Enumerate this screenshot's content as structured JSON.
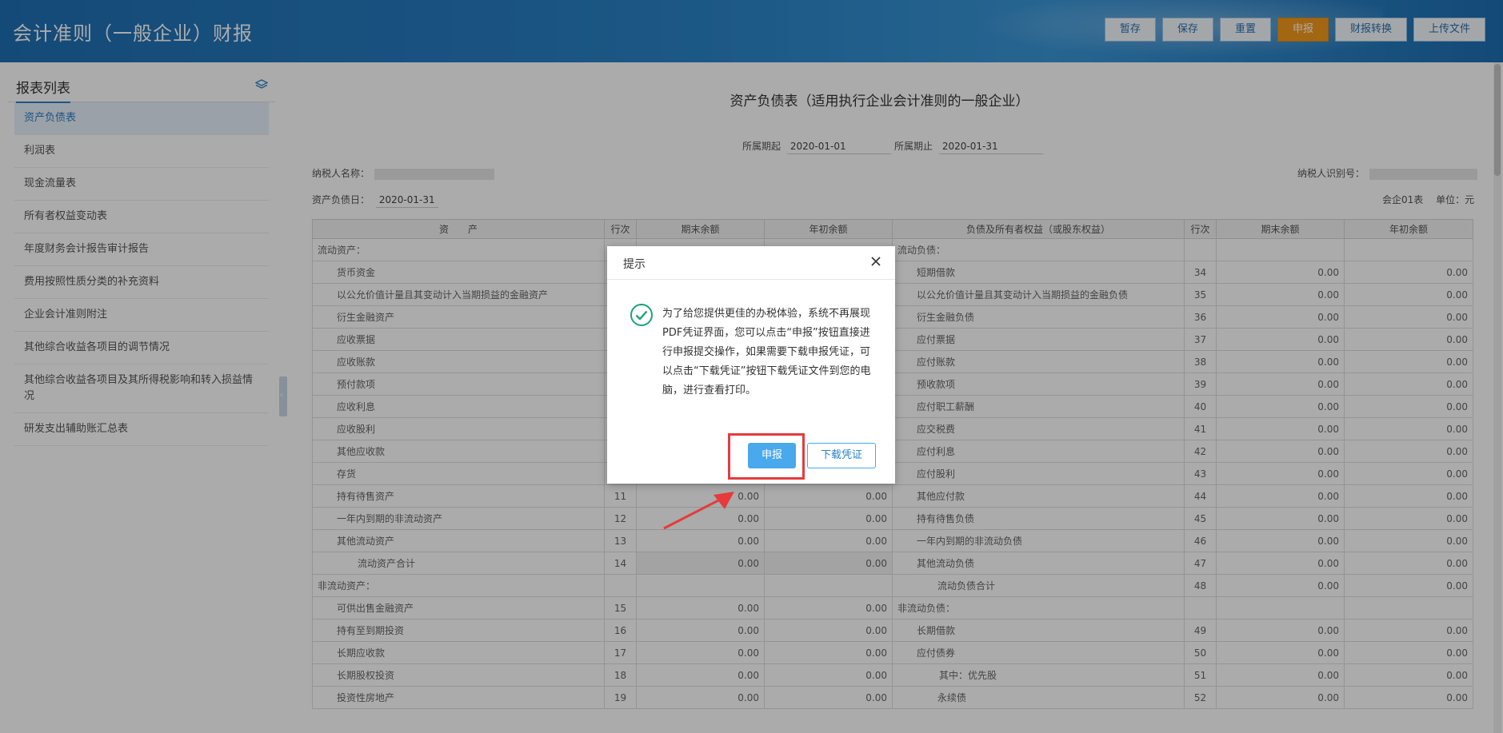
{
  "app": {
    "title": "会计准则（一般企业）财报"
  },
  "toolbar": {
    "buttons": [
      {
        "label": "暂存"
      },
      {
        "label": "保存"
      },
      {
        "label": "重置"
      },
      {
        "label": "申报"
      },
      {
        "label": "财报转换"
      },
      {
        "label": "上传文件"
      }
    ],
    "accent": "#f39a1d"
  },
  "sidebar": {
    "title": "报表列表",
    "icon": "layers-icon",
    "items": [
      {
        "label": "资产负债表"
      },
      {
        "label": "利润表"
      },
      {
        "label": "现金流量表"
      },
      {
        "label": "所有者权益变动表"
      },
      {
        "label": "年度财务会计报告审计报告"
      },
      {
        "label": "费用按照性质分类的补充资料"
      },
      {
        "label": "企业会计准则附注"
      },
      {
        "label": "其他综合收益各项目的调节情况"
      },
      {
        "label": "其他综合收益各项目及其所得税影响和转入损益情况"
      },
      {
        "label": "研发支出辅助账汇总表"
      }
    ]
  },
  "report": {
    "title": "资产负债表（适用执行企业会计准则的一般企业）",
    "period_start_label": "所属期起",
    "period_start": "2020-01-01",
    "period_end_label": "所属期止",
    "period_end": "2020-01-31",
    "taxpayer_name_label": "纳税人名称：",
    "taxpayer_id_label": "纳税人识别号：",
    "date_label": "资产负债日：",
    "date": "2020-01-31",
    "form_no": "会企01表",
    "unit": "单位：元",
    "headers": [
      "资　　产",
      "行次",
      "期末余额",
      "年初余额",
      "负债及所有者权益（或股东权益）",
      "行次",
      "期末余额",
      "年初余额"
    ],
    "rows": [
      [
        "流动资产：",
        "",
        "",
        "",
        "流动负债：",
        "",
        "",
        ""
      ],
      [
        "货币资金",
        "",
        "",
        "",
        "短期借款",
        "34",
        "0.00",
        "0.00"
      ],
      [
        "以公允价值计量且其变动计入当期损益的金融资产",
        "",
        "",
        "",
        "以公允价值计量且其变动计入当期损益的金融负债",
        "35",
        "0.00",
        "0.00"
      ],
      [
        "衍生金融资产",
        "",
        "",
        "",
        "衍生金融负债",
        "36",
        "0.00",
        "0.00"
      ],
      [
        "应收票据",
        "",
        "",
        "",
        "应付票据",
        "37",
        "0.00",
        "0.00"
      ],
      [
        "应收账款",
        "",
        "",
        "",
        "应付账款",
        "38",
        "0.00",
        "0.00"
      ],
      [
        "预付款项",
        "",
        "",
        "",
        "预收款项",
        "39",
        "0.00",
        "0.00"
      ],
      [
        "应收利息",
        "",
        "",
        "",
        "应付职工薪酬",
        "40",
        "0.00",
        "0.00"
      ],
      [
        "应收股利",
        "",
        "",
        "",
        "应交税费",
        "41",
        "0.00",
        "0.00"
      ],
      [
        "其他应收款",
        "",
        "",
        "",
        "应付利息",
        "42",
        "0.00",
        "0.00"
      ],
      [
        "存货",
        "",
        "",
        "",
        "应付股利",
        "43",
        "0.00",
        "0.00"
      ],
      [
        "持有待售资产",
        "11",
        "0.00",
        "0.00",
        "其他应付款",
        "44",
        "0.00",
        "0.00"
      ],
      [
        "一年内到期的非流动资产",
        "12",
        "0.00",
        "0.00",
        "持有待售负债",
        "45",
        "0.00",
        "0.00"
      ],
      [
        "其他流动资产",
        "13",
        "0.00",
        "0.00",
        "一年内到期的非流动负债",
        "46",
        "0.00",
        "0.00"
      ],
      [
        "流动资产合计",
        "14",
        "0.00",
        "0.00",
        "其他流动负债",
        "47",
        "0.00",
        "0.00"
      ],
      [
        "非流动资产：",
        "",
        "",
        "",
        "流动负债合计",
        "48",
        "0.00",
        "0.00"
      ],
      [
        "可供出售金融资产",
        "15",
        "0.00",
        "0.00",
        "非流动负债：",
        "",
        "",
        ""
      ],
      [
        "持有至到期投资",
        "16",
        "0.00",
        "0.00",
        "长期借款",
        "49",
        "0.00",
        "0.00"
      ],
      [
        "长期应收款",
        "17",
        "0.00",
        "0.00",
        "应付债券",
        "50",
        "0.00",
        "0.00"
      ],
      [
        "长期股权投资",
        "18",
        "0.00",
        "0.00",
        "其中：优先股",
        "51",
        "0.00",
        "0.00"
      ],
      [
        "投资性房地产",
        "19",
        "0.00",
        "0.00",
        "永续债",
        "52",
        "0.00",
        "0.00"
      ]
    ]
  },
  "dialog": {
    "title": "提示",
    "message": "为了给您提供更佳的办税体验，系统不再展现PDF凭证界面，您可以点击“申报”按钮直接进行申报提交操作，如果需要下载申报凭证，可以点击“下载凭证”按钮下载凭证文件到您的电脑，进行查看打印。",
    "submit_label": "申报",
    "download_label": "下载凭证",
    "icon": "check-circle-icon",
    "icon_color": "#1aa37a",
    "highlight_color": "#e53b3b"
  }
}
